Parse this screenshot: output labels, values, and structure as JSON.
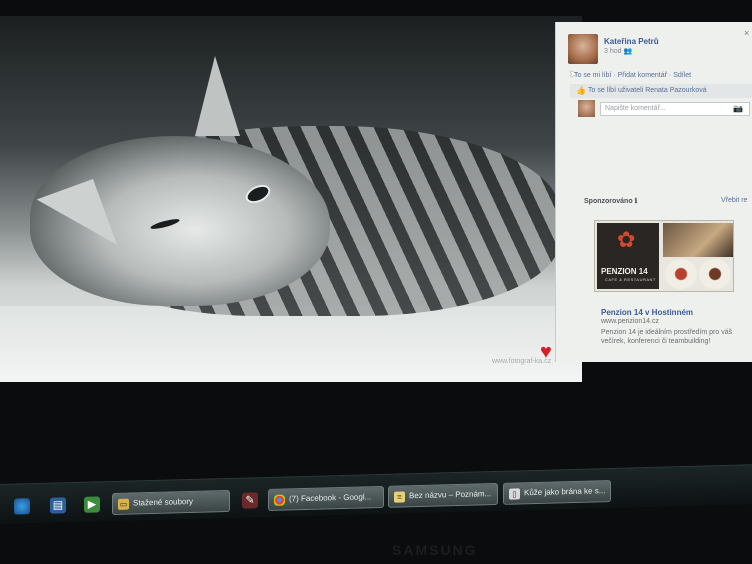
{
  "post": {
    "author": "Kateřina Petrů",
    "time": "3 hod",
    "actions": "To se mi líbí · Přidat komentář · Sdílet",
    "likes_text": "To se líbí uživateli Renata Pazourková",
    "comment_placeholder": "Napište komentář...",
    "photo_watermark": "www.fotograf-ka.cz"
  },
  "sponsored": {
    "heading": "Sponzorováno",
    "more": "Vřebit re",
    "ad_image_brand": "PENZION 14",
    "ad_image_sub": "CAFE & RESTAURANT",
    "ad_title": "Penzion 14 v Hostinném",
    "ad_url": "www.penzion14.cz",
    "ad_text": "Penzion 14 je ideálním prostředím pro váš večírek, konferenci či teambuilding!"
  },
  "taskbar": {
    "buttons": [
      {
        "label": "Stažené soubory"
      },
      {
        "label": "(7) Facebook - Googl..."
      },
      {
        "label": "Bez názvu – Poznám..."
      },
      {
        "label": "Kůže jako brána ke s..."
      }
    ]
  },
  "monitor_brand": "SAMSUNG",
  "colors": {
    "facebook_blue": "#3b5998",
    "heart": "#d41f26"
  }
}
